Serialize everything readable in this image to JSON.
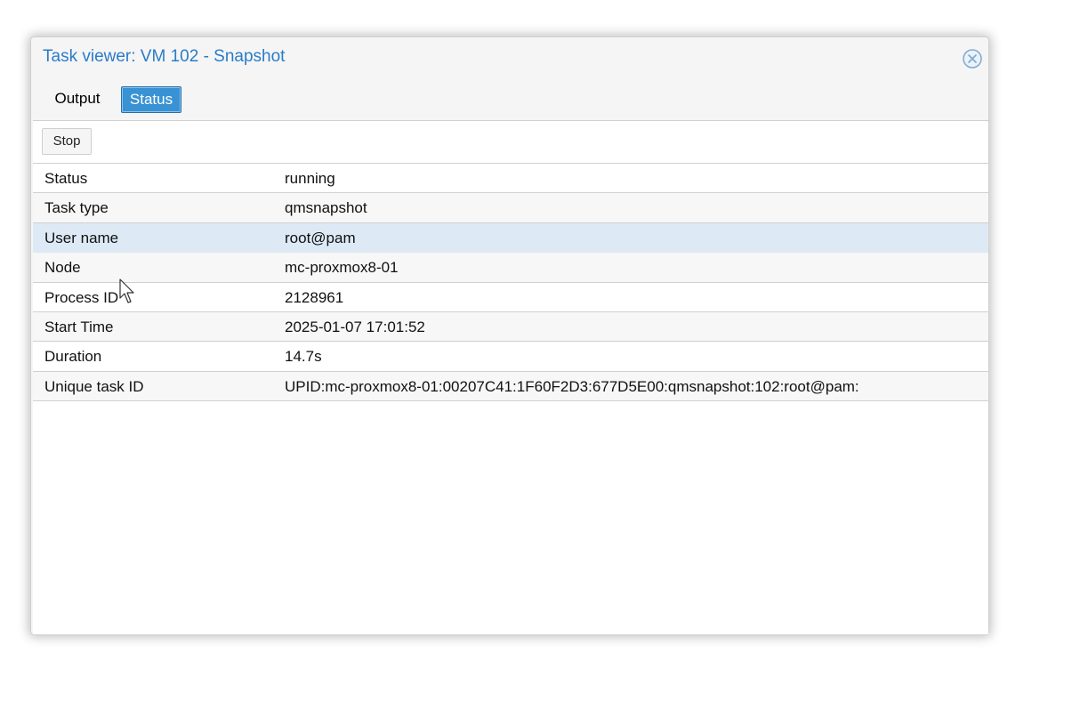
{
  "window": {
    "title": "Task viewer: VM 102 - Snapshot",
    "close_icon": "close-circle-icon"
  },
  "tabs": [
    {
      "label": "Output",
      "active": false
    },
    {
      "label": "Status",
      "active": true
    }
  ],
  "toolbar": {
    "stop_label": "Stop"
  },
  "status_rows": [
    {
      "key": "Status",
      "value": "running"
    },
    {
      "key": "Task type",
      "value": "qmsnapshot"
    },
    {
      "key": "User name",
      "value": "root@pam",
      "selected": true
    },
    {
      "key": "Node",
      "value": "mc-proxmox8-01"
    },
    {
      "key": "Process ID",
      "value": "2128961"
    },
    {
      "key": "Start Time",
      "value": "2025-01-07 17:01:52"
    },
    {
      "key": "Duration",
      "value": "14.7s"
    },
    {
      "key": "Unique task ID",
      "value": "UPID:mc-proxmox8-01:00207C41:1F60F2D3:677D5E00:qmsnapshot:102:root@pam:"
    }
  ],
  "colors": {
    "accent": "#2a7cc7",
    "active_tab": "#3892d4",
    "selected_row": "#ddeaf6"
  }
}
